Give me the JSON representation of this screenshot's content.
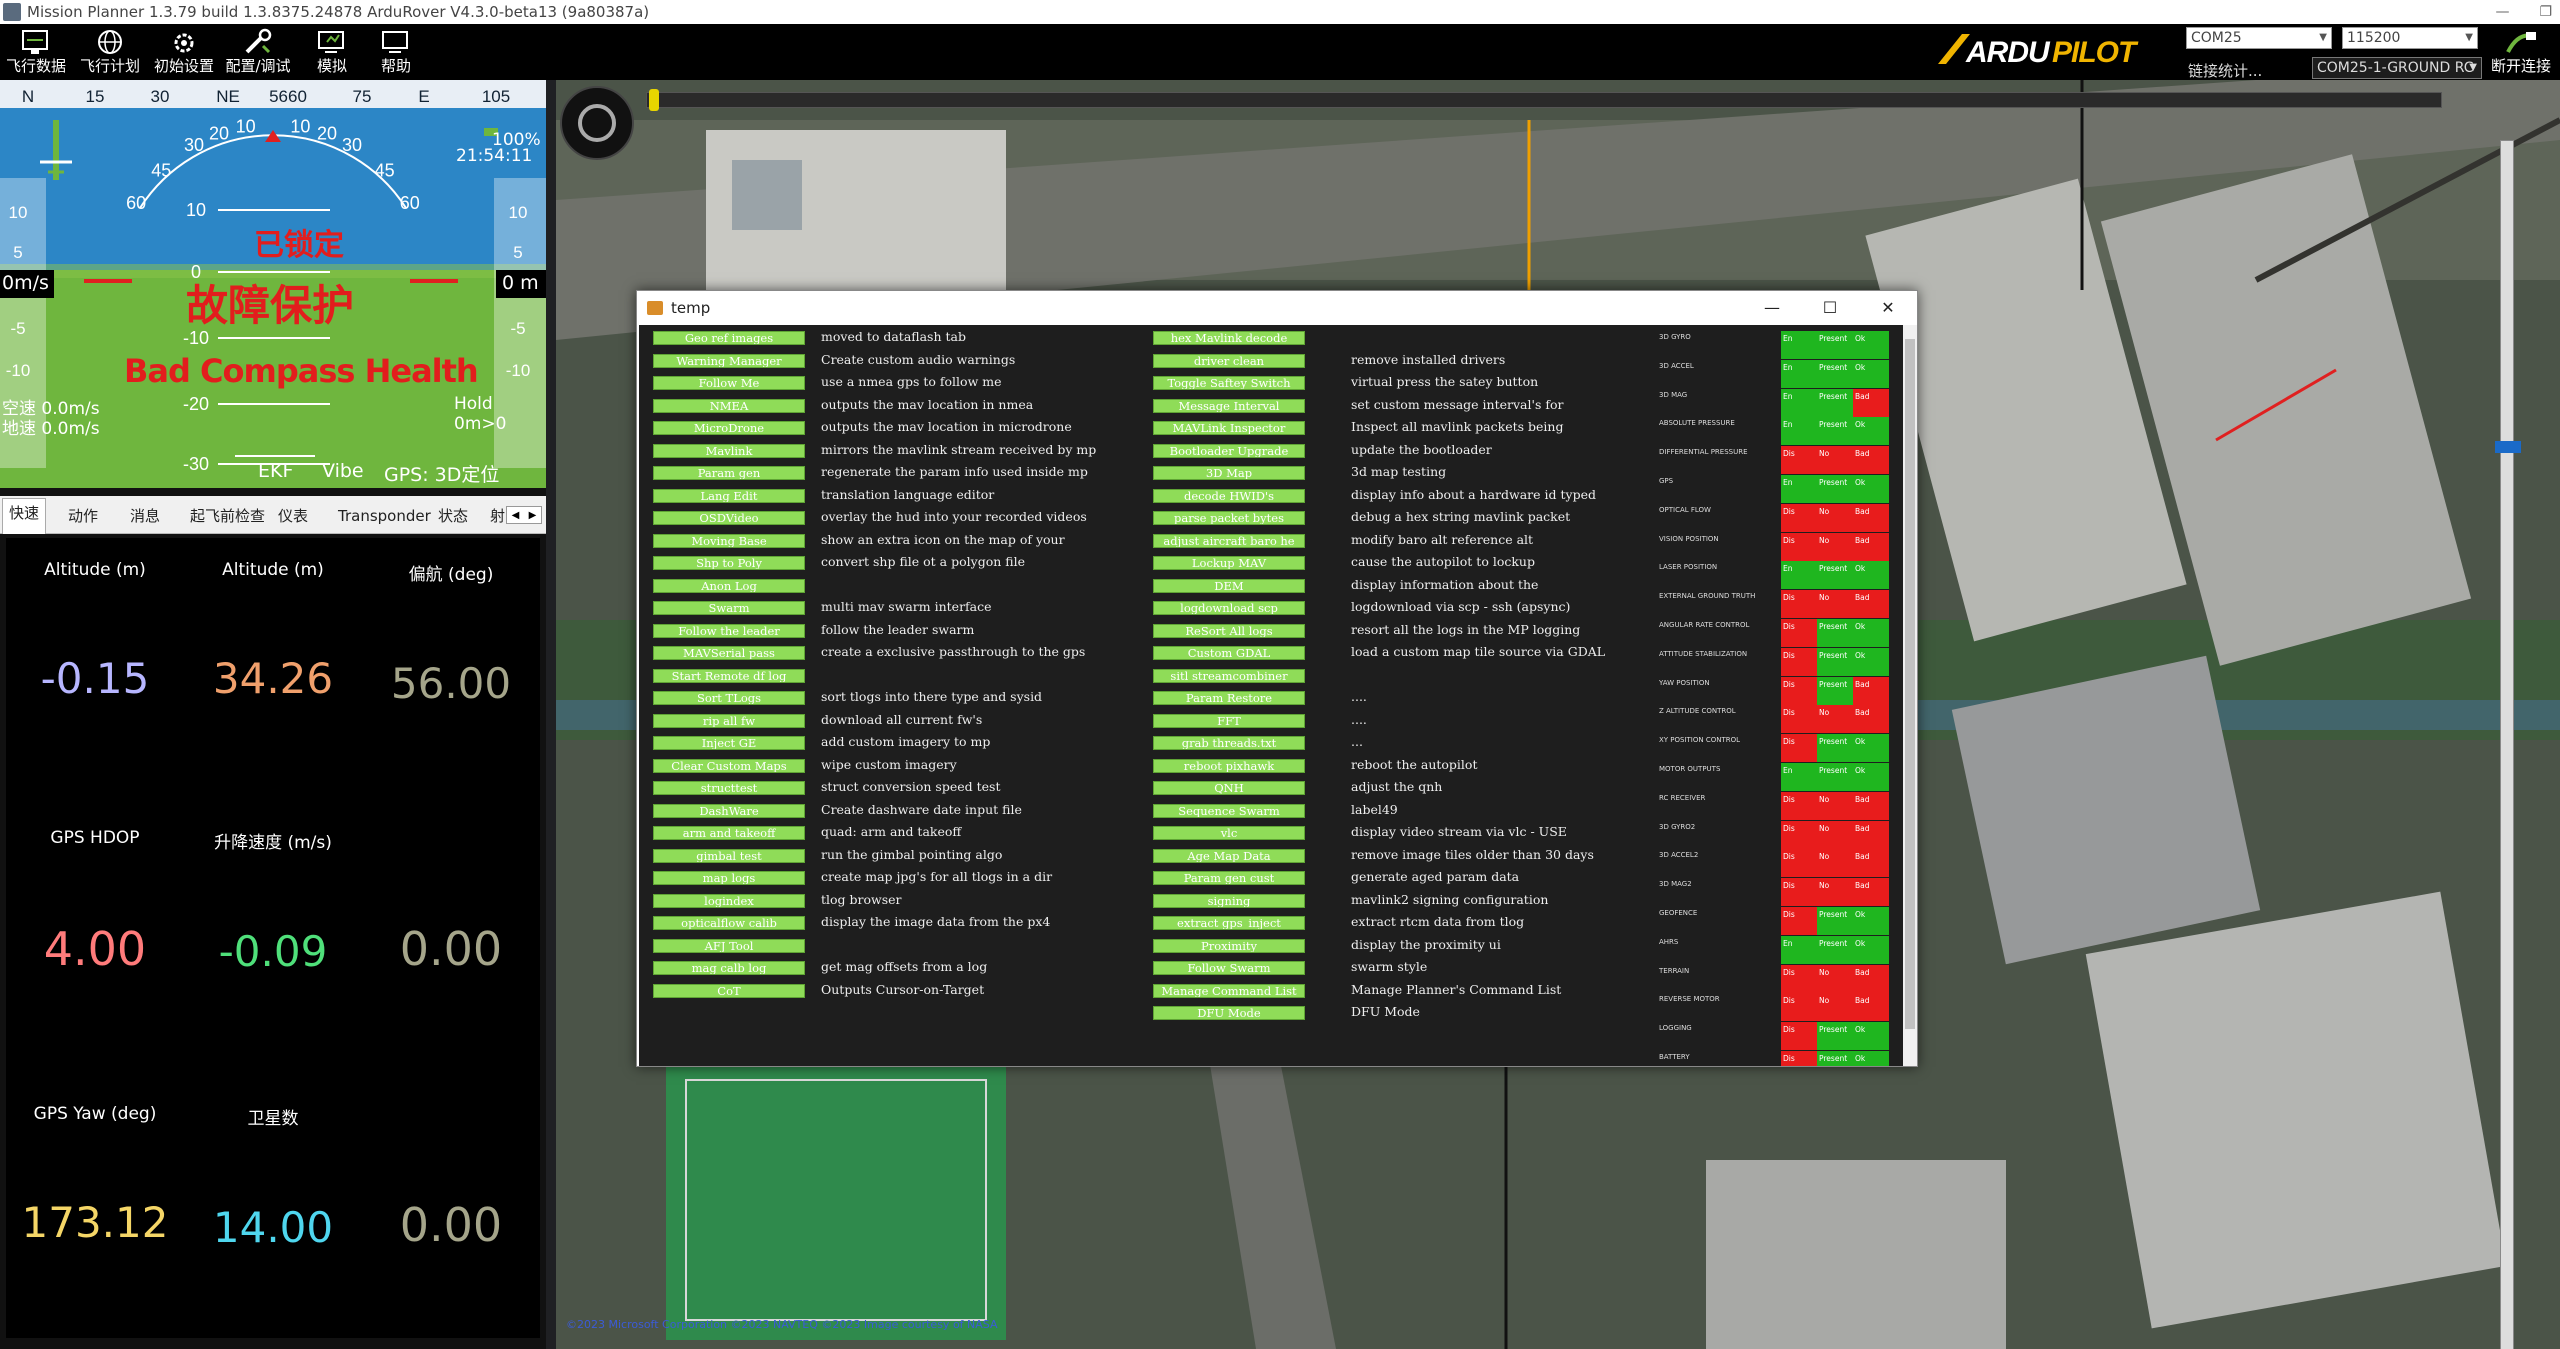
{
  "titlebar": {
    "title": "Mission Planner 1.3.79 build 1.3.8375.24878 ArduRover V4.3.0-beta13 (9a80387a)"
  },
  "toolbar": {
    "buttons": [
      "飞行数据",
      "飞行计划",
      "初始设置",
      "配置/调试",
      "模拟",
      "帮助"
    ],
    "logo": "ARDUPILOT",
    "port": "COM25",
    "baud": "115200",
    "conn_link": "链接统计...",
    "conn_select": "COM25-1-GROUND RC",
    "disconnect": "断开连接"
  },
  "hud": {
    "heading_tape": [
      "N",
      "15",
      "30",
      "NE",
      "5660",
      "75",
      "E",
      "105"
    ],
    "roll_scale": [
      "60",
      "45",
      "30",
      "20",
      "10",
      "0",
      "10",
      "20",
      "30",
      "45",
      "60"
    ],
    "pitch_labels": [
      "10",
      "0",
      "-10",
      "-20",
      "-30"
    ],
    "left_ticks": [
      "10",
      "5",
      "-5",
      "-10"
    ],
    "right_ticks": [
      "10",
      "5",
      "-5",
      "-10"
    ],
    "speed": "0m/s",
    "alt": "0 m",
    "battery": "100%",
    "time": "21:54:11",
    "status1": "已锁定",
    "status2": "故障保护",
    "status3": "Bad Compass Health",
    "airspeed": "空速 0.0m/s",
    "groundspeed": "地速 0.0m/s",
    "hold": "Hold",
    "hold_sub": "0m>0",
    "ekf": "EKF",
    "vibe": "Vibe",
    "gps": "GPS: 3D定位",
    "colors": {
      "sky": "#2c86c6",
      "ground": "#6fb63e"
    }
  },
  "tabs": [
    "快速",
    "动作",
    "消息",
    "起飞前检查",
    "仪表",
    "Transponder",
    "状态",
    "射"
  ],
  "quick": [
    {
      "label": "Altitude (m)",
      "value": "-0.15",
      "color": "#b7b6ff"
    },
    {
      "label": "Altitude (m)",
      "value": "34.26",
      "color": "#f0a06c"
    },
    {
      "label": "偏航 (deg)",
      "value": "56.00",
      "color": "#a5a58a"
    },
    {
      "label": "GPS HDOP",
      "value": "4.00",
      "color": "#ff7b7b"
    },
    {
      "label": "升降速度 (m/s)",
      "value": "-0.09",
      "color": "#4fe07a"
    },
    {
      "label": "",
      "value": "0.00",
      "color": "#a5a58a"
    },
    {
      "label": "GPS Yaw (deg)",
      "value": "173.12",
      "color": "#f5d667"
    },
    {
      "label": "卫星数",
      "value": "14.00",
      "color": "#4fd6ee"
    },
    {
      "label": "",
      "value": "0.00",
      "color": "#a5a58a"
    }
  ],
  "map": {
    "copyright": "©2023 Microsoft Corporation ©2023 NAVTEQ ©2023 Image courtesy of NASA"
  },
  "dialog": {
    "title": "temp",
    "col1": [
      {
        "b": "Geo ref images",
        "d": "moved to dataflash tab"
      },
      {
        "b": "Warning Manager",
        "d": "Create custom audio warnings"
      },
      {
        "b": "Follow Me",
        "d": "use a nmea gps to follow me"
      },
      {
        "b": "NMEA",
        "d": "outputs the mav location in nmea"
      },
      {
        "b": "MicroDrone",
        "d": "outputs the mav location in microdrone"
      },
      {
        "b": "Mavlink",
        "d": "mirrors the mavlink stream received by mp"
      },
      {
        "b": "Param gen",
        "d": "regenerate the param info used inside mp"
      },
      {
        "b": "Lang Edit",
        "d": "translation language editor"
      },
      {
        "b": "OSDVideo",
        "d": "overlay the hud into your recorded videos"
      },
      {
        "b": "Moving Base",
        "d": "show an extra icon on the map of your"
      },
      {
        "b": "Shp to Poly",
        "d": "convert shp file ot a polygon file"
      },
      {
        "b": "Anon Log",
        "d": ""
      },
      {
        "b": "Swarm",
        "d": "multi mav swarm interface"
      },
      {
        "b": "Follow the leader",
        "d": "follow the leader swarm"
      },
      {
        "b": "MAVSerial pass",
        "d": "create a exclusive passthrough to the gps"
      },
      {
        "b": "Start Remote df log",
        "d": ""
      },
      {
        "b": "Sort TLogs",
        "d": "sort tlogs into there type and sysid"
      },
      {
        "b": "rip all fw",
        "d": "download all current fw's"
      },
      {
        "b": "Inject GE",
        "d": "add custom imagery to mp"
      },
      {
        "b": "Clear Custom Maps",
        "d": "wipe custom imagery"
      },
      {
        "b": "structtest",
        "d": "struct conversion speed test"
      },
      {
        "b": "DashWare",
        "d": "Create dashware date input file"
      },
      {
        "b": "arm and takeoff",
        "d": "quad: arm and takeoff"
      },
      {
        "b": "gimbal test",
        "d": "run the gimbal pointing algo"
      },
      {
        "b": "map logs",
        "d": "create map jpg's for all tlogs in a dir"
      },
      {
        "b": "logindex",
        "d": "tlog browser"
      },
      {
        "b": "opticalflow calib",
        "d": "display the image data from the px4"
      },
      {
        "b": "AFJ Tool",
        "d": ""
      },
      {
        "b": "mag calb log",
        "d": "get mag offsets from a log"
      },
      {
        "b": "CoT",
        "d": "Outputs Cursor-on-Target"
      }
    ],
    "col2": [
      {
        "b": "hex Mavlink decode",
        "d": ""
      },
      {
        "b": "driver clean",
        "d": "remove installed drivers"
      },
      {
        "b": "Toggle Saftey Switch",
        "d": "virtual press the satey button"
      },
      {
        "b": "Message Interval",
        "d": "set custom message interval's for"
      },
      {
        "b": "MAVLink Inspector",
        "d": "Inspect all mavlink packets being"
      },
      {
        "b": "Bootloader Upgrade",
        "d": "update the bootloader"
      },
      {
        "b": "3D Map",
        "d": "3d map testing"
      },
      {
        "b": "decode HWID's",
        "d": "display info about a hardware id typed"
      },
      {
        "b": "parse packet bytes",
        "d": "debug a hex string mavlink packet"
      },
      {
        "b": "adjust aircraft baro he",
        "d": "modify baro alt reference alt"
      },
      {
        "b": "Lockup MAV",
        "d": "cause the autopilot to lockup"
      },
      {
        "b": "DEM",
        "d": "display information about the"
      },
      {
        "b": "logdownload scp",
        "d": "logdownload via scp - ssh (apsync)"
      },
      {
        "b": "ReSort All logs",
        "d": "resort all the logs in the MP logging"
      },
      {
        "b": "Custom GDAL",
        "d": "load a custom map tile source via GDAL"
      },
      {
        "b": "sitl streamcombiner",
        "d": ""
      },
      {
        "b": "Param Restore",
        "d": "...."
      },
      {
        "b": "FFT",
        "d": "...."
      },
      {
        "b": "grab threads.txt",
        "d": "..."
      },
      {
        "b": "reboot pixhawk",
        "d": "reboot the autopilot"
      },
      {
        "b": "QNH",
        "d": "adjust the qnh"
      },
      {
        "b": "Sequence Swarm",
        "d": "label49"
      },
      {
        "b": "vlc",
        "d": "display video stream via vlc - USE"
      },
      {
        "b": "Age Map Data",
        "d": "remove image tiles older than 30 days"
      },
      {
        "b": "Param gen cust",
        "d": "generate aged param data"
      },
      {
        "b": "signing",
        "d": "mavlink2 signing configuration"
      },
      {
        "b": "extract gps_inject",
        "d": "extract rtcm data from tlog"
      },
      {
        "b": "Proximity",
        "d": "display the proximity ui"
      },
      {
        "b": "Follow Swarm",
        "d": "swarm style"
      },
      {
        "b": "Manage Command List",
        "d": "Manage Planner's Command List"
      },
      {
        "b": "DFU Mode",
        "d": "DFU Mode"
      }
    ],
    "sensors": [
      {
        "n": "3D GYRO",
        "e": "En",
        "p": "Present",
        "h": "Ok"
      },
      {
        "n": "3D ACCEL",
        "e": "En",
        "p": "Present",
        "h": "Ok"
      },
      {
        "n": "3D MAG",
        "e": "En",
        "p": "Present",
        "h": "Bad"
      },
      {
        "n": "ABSOLUTE PRESSURE",
        "e": "En",
        "p": "Present",
        "h": "Ok"
      },
      {
        "n": "DIFFERENTIAL PRESSURE",
        "e": "Dis",
        "p": "No",
        "h": "Bad"
      },
      {
        "n": "GPS",
        "e": "En",
        "p": "Present",
        "h": "Ok"
      },
      {
        "n": "OPTICAL FLOW",
        "e": "Dis",
        "p": "No",
        "h": "Bad"
      },
      {
        "n": "VISION POSITION",
        "e": "Dis",
        "p": "No",
        "h": "Bad"
      },
      {
        "n": "LASER POSITION",
        "e": "En",
        "p": "Present",
        "h": "Ok"
      },
      {
        "n": "EXTERNAL GROUND TRUTH",
        "e": "Dis",
        "p": "No",
        "h": "Bad"
      },
      {
        "n": "ANGULAR RATE CONTROL",
        "e": "Dis",
        "p": "Present",
        "h": "Ok"
      },
      {
        "n": "ATTITUDE STABILIZATION",
        "e": "Dis",
        "p": "Present",
        "h": "Ok"
      },
      {
        "n": "YAW POSITION",
        "e": "Dis",
        "p": "Present",
        "h": "Bad"
      },
      {
        "n": "Z ALTITUDE CONTROL",
        "e": "Dis",
        "p": "No",
        "h": "Bad"
      },
      {
        "n": "XY POSITION CONTROL",
        "e": "Dis",
        "p": "Present",
        "h": "Ok"
      },
      {
        "n": "MOTOR OUTPUTS",
        "e": "En",
        "p": "Present",
        "h": "Ok"
      },
      {
        "n": "RC RECEIVER",
        "e": "Dis",
        "p": "No",
        "h": "Bad"
      },
      {
        "n": "3D GYRO2",
        "e": "Dis",
        "p": "No",
        "h": "Bad"
      },
      {
        "n": "3D ACCEL2",
        "e": "Dis",
        "p": "No",
        "h": "Bad"
      },
      {
        "n": "3D MAG2",
        "e": "Dis",
        "p": "No",
        "h": "Bad"
      },
      {
        "n": "GEOFENCE",
        "e": "Dis",
        "p": "Present",
        "h": "Ok"
      },
      {
        "n": "AHRS",
        "e": "En",
        "p": "Present",
        "h": "Ok"
      },
      {
        "n": "TERRAIN",
        "e": "Dis",
        "p": "No",
        "h": "Bad"
      },
      {
        "n": "REVERSE MOTOR",
        "e": "Dis",
        "p": "No",
        "h": "Bad"
      },
      {
        "n": "LOGGING",
        "e": "Dis",
        "p": "Present",
        "h": "Ok"
      },
      {
        "n": "BATTERY",
        "e": "Dis",
        "p": "Present",
        "h": "Ok"
      }
    ]
  }
}
